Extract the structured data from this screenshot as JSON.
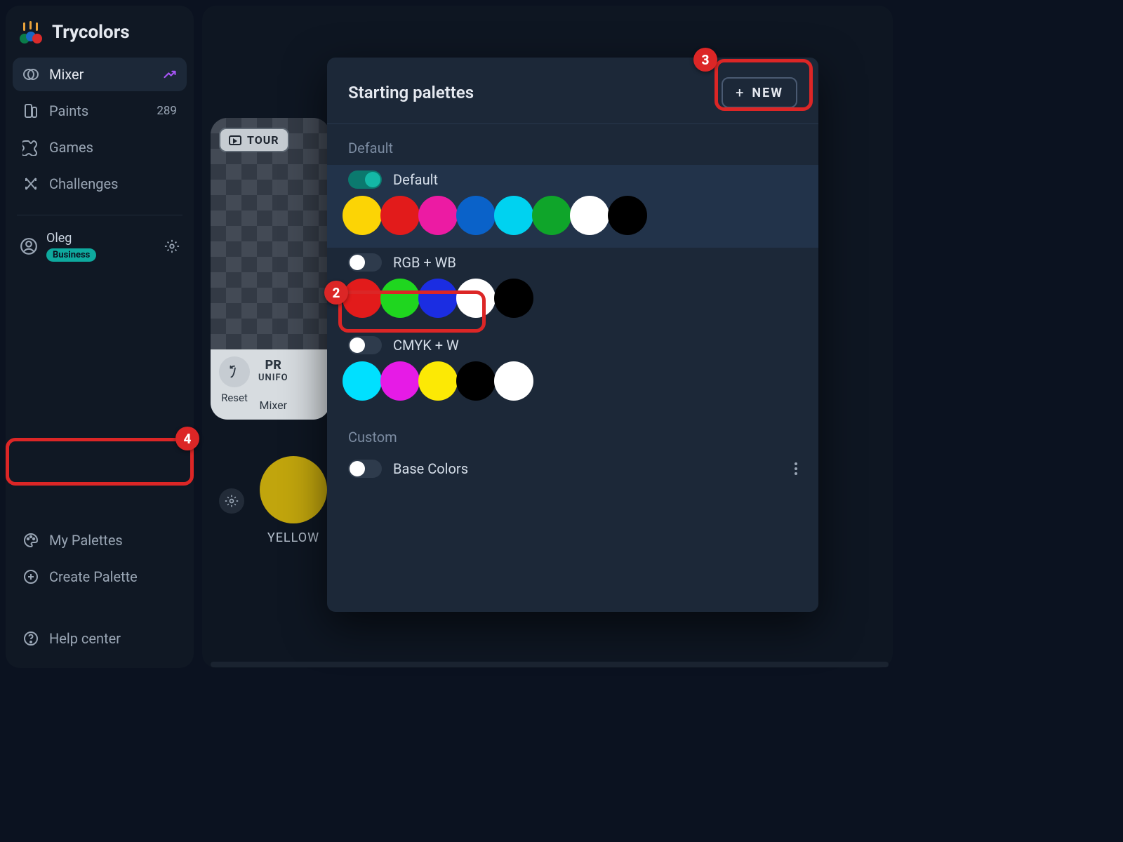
{
  "app_title": "Trycolors",
  "sidebar": {
    "nav": [
      {
        "id": "mixer",
        "label": "Mixer",
        "active": true,
        "trend": true
      },
      {
        "id": "paints",
        "label": "Paints",
        "count": "289"
      },
      {
        "id": "games",
        "label": "Games"
      },
      {
        "id": "challenges",
        "label": "Challenges"
      }
    ],
    "user": {
      "name": "Oleg",
      "badge": "Business"
    },
    "my_palettes": "My Palettes",
    "create_palette": "Create Palette",
    "help_center": "Help center"
  },
  "card": {
    "tour_label": "TOUR",
    "title": "PR",
    "subtitle": "UNIFORM",
    "reset": "Reset",
    "mixer": "Mixer"
  },
  "swatch": {
    "name": "YELLOW",
    "color": "#c1a50d"
  },
  "modal": {
    "title": "Starting palettes",
    "new_label": "NEW",
    "sections": {
      "default": "Default",
      "custom": "Custom"
    },
    "palettes": [
      {
        "name": "Default",
        "on": true,
        "colors": [
          "#fcd405",
          "#e21b1b",
          "#ec1ba3",
          "#0a62c9",
          "#00d2f0",
          "#0fa52a",
          "#ffffff",
          "#000000"
        ]
      },
      {
        "name": "RGB + WB",
        "on": false,
        "colors": [
          "#e21b1b",
          "#1fd61f",
          "#1b2de2",
          "#ffffff",
          "#000000"
        ]
      },
      {
        "name": "CMYK + W",
        "on": false,
        "colors": [
          "#00e0ff",
          "#e61be6",
          "#fce905",
          "#000000",
          "#ffffff"
        ]
      },
      {
        "name": "Base Colors",
        "on": false,
        "colors": []
      }
    ]
  },
  "markers": {
    "m2": "2",
    "m3": "3",
    "m4": "4"
  }
}
